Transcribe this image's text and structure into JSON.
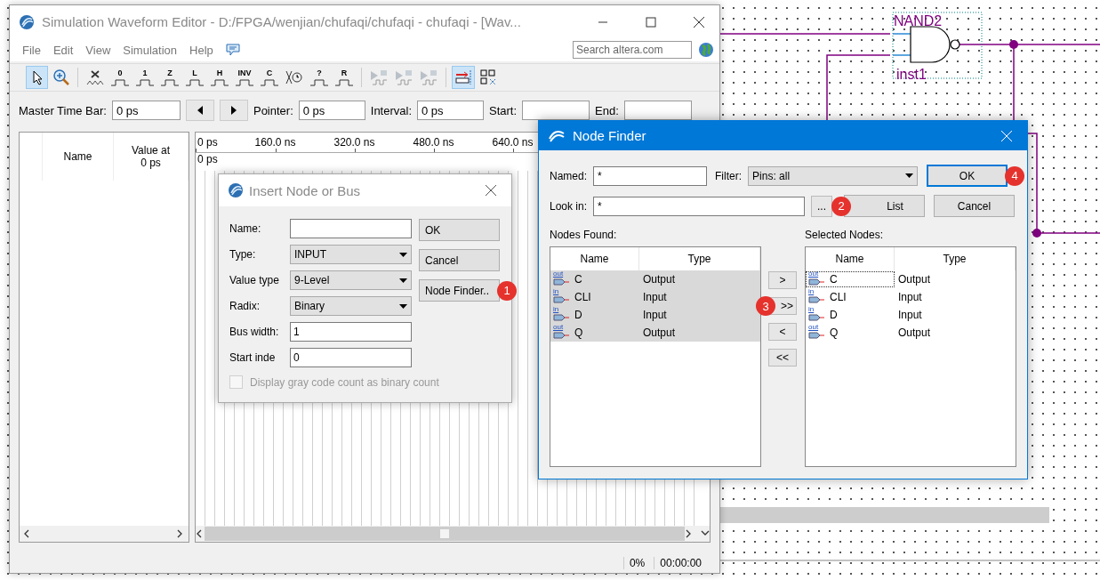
{
  "schematic": {
    "gate_label": "NAND2",
    "instance": "inst1"
  },
  "main_window": {
    "title": "Simulation Waveform Editor - D:/FPGA/wenjian/chufaqi/chufaqi - chufaqi - [Wav...",
    "menu": [
      "File",
      "Edit",
      "View",
      "Simulation",
      "Help"
    ],
    "search": {
      "placeholder": "Search altera.com"
    },
    "toolbar": [
      {
        "kind": "pointer",
        "selected": true,
        "disabled": false
      },
      {
        "kind": "zoom",
        "selected": false,
        "disabled": false
      },
      {
        "kind": "unknown",
        "selected": false,
        "disabled": false
      },
      {
        "kind": "value",
        "glyph": "0",
        "selected": false,
        "disabled": false
      },
      {
        "kind": "value",
        "glyph": "1",
        "selected": false,
        "disabled": false
      },
      {
        "kind": "value",
        "glyph": "Z",
        "selected": false,
        "disabled": false
      },
      {
        "kind": "value",
        "glyph": "L",
        "selected": false,
        "disabled": false
      },
      {
        "kind": "value",
        "glyph": "H",
        "selected": false,
        "disabled": false
      },
      {
        "kind": "value",
        "glyph": "INV",
        "selected": false,
        "disabled": false
      },
      {
        "kind": "value",
        "glyph": "C",
        "selected": false,
        "disabled": false
      },
      {
        "kind": "count",
        "selected": false,
        "disabled": false
      },
      {
        "kind": "value",
        "glyph": "?",
        "selected": false,
        "disabled": false
      },
      {
        "kind": "value",
        "glyph": "R",
        "selected": false,
        "disabled": false
      },
      {
        "kind": "simulate",
        "selected": false,
        "disabled": true
      },
      {
        "kind": "simulate",
        "selected": false,
        "disabled": true
      },
      {
        "kind": "simulate",
        "selected": false,
        "disabled": true
      },
      {
        "kind": "snap",
        "selected": true,
        "disabled": false
      },
      {
        "kind": "grid",
        "selected": false,
        "disabled": false
      }
    ],
    "time_bar": [
      {
        "label": "Master Time Bar:",
        "value": "0 ps"
      },
      {
        "label": "Pointer:",
        "value": "0 ps"
      },
      {
        "label": "Interval:",
        "value": "0 ps"
      },
      {
        "label": "Start:"
      },
      {
        "label": "End:"
      }
    ],
    "signal_columns": [
      "Name",
      "Value at 0 ps"
    ],
    "ruler": [
      "0 ps",
      "160.0 ns",
      "320.0 ns",
      "480.0 ns",
      "640.0 ns"
    ],
    "cursor_label": "0 ps",
    "status": {
      "progress": "0%",
      "elapsed": "00:00:00"
    }
  },
  "insert_dialog": {
    "title": "Insert Node or Bus",
    "fields": [
      {
        "kind": "text",
        "label": "Name:"
      },
      {
        "kind": "select",
        "label": "Type:",
        "value": "INPUT"
      },
      {
        "kind": "select",
        "label": "Value type",
        "value": "9-Level"
      },
      {
        "kind": "select",
        "label": "Radix:",
        "value": "Binary"
      },
      {
        "kind": "text",
        "label": "Bus width:",
        "value": "1"
      },
      {
        "kind": "text",
        "label": "Start inde",
        "value": "0"
      }
    ],
    "checkbox": {
      "label": "Display gray code count as binary count",
      "checked": false,
      "disabled": true
    },
    "buttons": [
      {
        "label": "OK"
      },
      {
        "label": "Cancel"
      },
      {
        "label": "Node Finder..",
        "badge": "1"
      }
    ]
  },
  "node_finder": {
    "title": "Node Finder",
    "named": {
      "label": "Named:",
      "value": "*"
    },
    "filter": {
      "label": "Filter:",
      "value": "Pins: all"
    },
    "look_in": {
      "label": "Look in:",
      "value": "*"
    },
    "browse": "...",
    "buttons": [
      {
        "label": "OK",
        "badge": "4",
        "default": true
      },
      {
        "label": "List",
        "badge": "2",
        "default": false
      },
      {
        "label": "Cancel",
        "default": false
      }
    ],
    "found_label": "Nodes Found:",
    "selected_label": "Selected Nodes:",
    "found_columns": [
      "Name",
      "Type"
    ],
    "selected_columns": [
      "Name",
      "Type"
    ],
    "found": [
      {
        "pin": "out",
        "name": "C",
        "type": "Output",
        "selected": true
      },
      {
        "pin": "in",
        "name": "CLI",
        "type": "Input",
        "selected": true
      },
      {
        "pin": "in",
        "name": "D",
        "type": "Input",
        "selected": true
      },
      {
        "pin": "out",
        "name": "Q",
        "type": "Output",
        "selected": true
      }
    ],
    "move_buttons": [
      {
        "label": ">"
      },
      {
        "label": ">>",
        "badge": "3"
      },
      {
        "label": "<"
      },
      {
        "label": "<<"
      }
    ],
    "chosen": [
      {
        "pin": "out",
        "name": "C",
        "type": "Output",
        "focused": true
      },
      {
        "pin": "in",
        "name": "CLI",
        "type": "Input",
        "focused": false
      },
      {
        "pin": "in",
        "name": "D",
        "type": "Input",
        "focused": false
      },
      {
        "pin": "out",
        "name": "Q",
        "type": "Output",
        "focused": false
      }
    ]
  }
}
